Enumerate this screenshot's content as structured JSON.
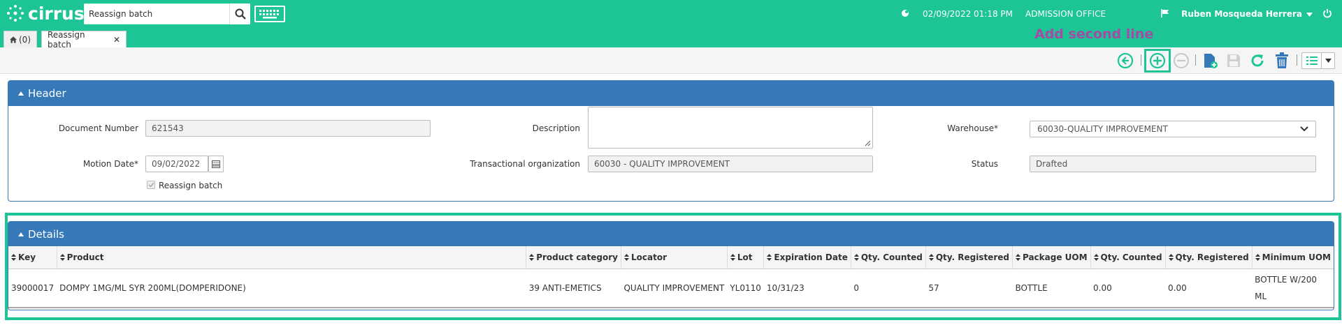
{
  "app": {
    "logo_text": "cirrus"
  },
  "search": {
    "value": "Reassign batch"
  },
  "status": {
    "datetime": "02/09/2022 01:18 PM",
    "office": "ADMISSION OFFICE",
    "user": "Ruben Mosqueda Herrera"
  },
  "tabs": [
    {
      "label": "(0)"
    },
    {
      "label": "Reassign batch"
    }
  ],
  "annotation": {
    "label": "Add second line"
  },
  "header": {
    "title": "Header",
    "document_number_label": "Document Number",
    "document_number": "621543",
    "description_label": "Description",
    "description": "",
    "warehouse_label": "Warehouse*",
    "warehouse": "60030-QUALITY IMPROVEMENT",
    "motion_date_label": "Motion Date*",
    "motion_date": "09/02/2022",
    "trans_org_label": "Transactional organization",
    "trans_org": "60030 - QUALITY IMPROVEMENT",
    "status_label": "Status",
    "status": "Drafted",
    "reassign_label": "Reassign batch"
  },
  "details": {
    "title": "Details",
    "columns": [
      "Key",
      "Product",
      "Product category",
      "Locator",
      "Lot",
      "Expiration Date",
      "Qty. Counted",
      "Qty. Registered",
      "Package UOM",
      "Qty. Counted",
      "Qty. Registered",
      "Minimum UOM"
    ],
    "rows": [
      [
        "39000017",
        "DOMPY 1MG/ML SYR 200ML(DOMPERIDONE)",
        "39 ANTI-EMETICS",
        "QUALITY IMPROVEMENT",
        "YL0110",
        "10/31/23",
        "0",
        "57",
        "BOTTLE",
        "0.00",
        "0.00",
        "BOTTLE W/200 ML"
      ]
    ]
  },
  "colors": {
    "brand": "#1dc596",
    "panel": "#3579b8",
    "annotation": "#a44ba5"
  }
}
